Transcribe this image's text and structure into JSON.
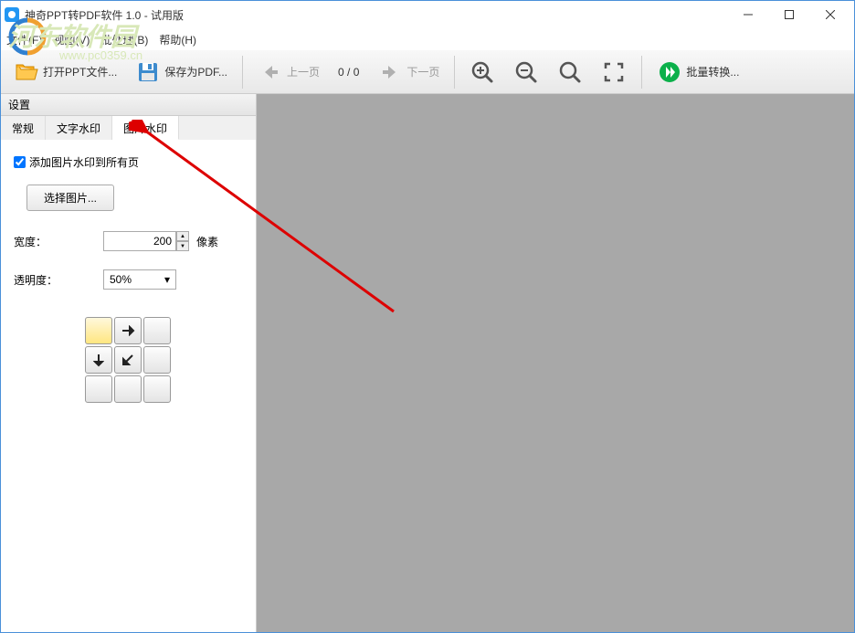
{
  "window": {
    "title": "神奇PPT转PDF软件 1.0 - 试用版"
  },
  "menu": {
    "file": "文件(F)",
    "view": "视图(V)",
    "batch": "批处理(B)",
    "help": "帮助(H)"
  },
  "watermark": {
    "main": "河东软件园",
    "sub": "www.pc0359.cn"
  },
  "toolbar": {
    "open": "打开PPT文件...",
    "save": "保存为PDF...",
    "prev": "上一页",
    "next": "下一页",
    "batch": "批量转换...",
    "page_count": "0 / 0"
  },
  "sidebar": {
    "title": "设置",
    "tabs": {
      "general": "常规",
      "text_wm": "文字水印",
      "image_wm": "图片水印"
    },
    "image_wm_panel": {
      "add_all": "添加图片水印到所有页",
      "choose": "选择图片...",
      "width_label": "宽度：",
      "width_value": "200",
      "width_unit": "像素",
      "opacity_label": "透明度：",
      "opacity_value": "50%"
    }
  }
}
